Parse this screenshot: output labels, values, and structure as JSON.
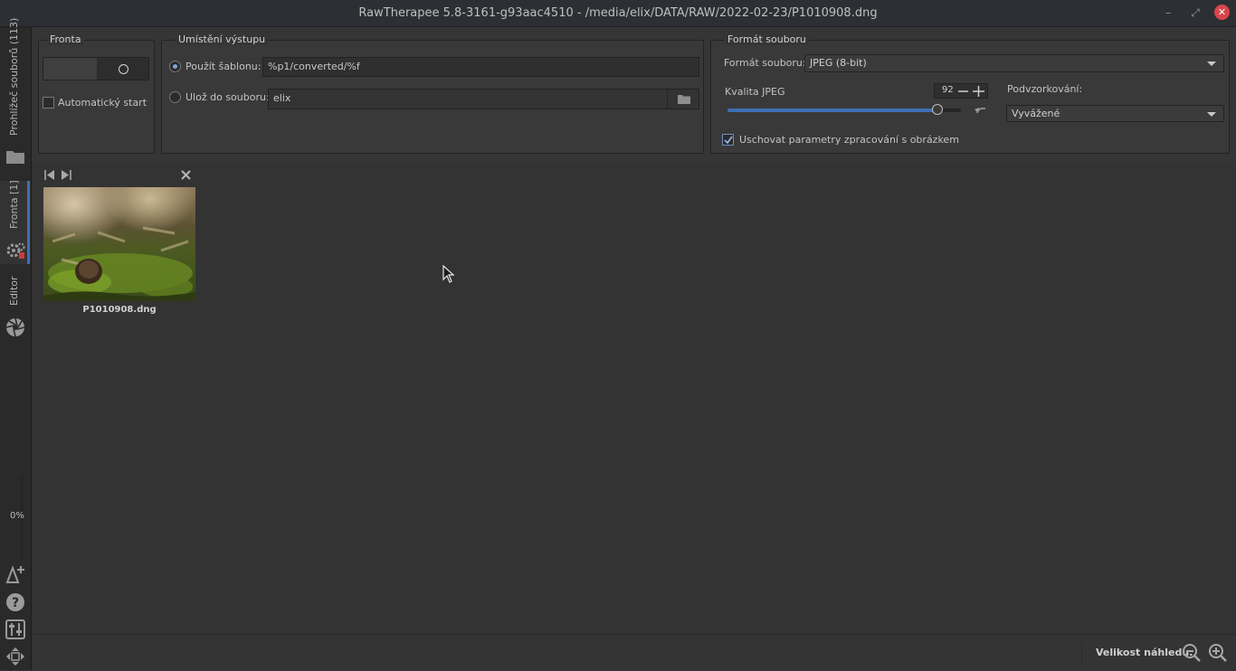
{
  "window": {
    "title": "RawTherapee 5.8-3161-g93aac4510 - /media/elix/DATA/RAW/2022-02-23/P1010908.dng",
    "minimize_glyph": "–",
    "maximize_glyph": "⤢",
    "close_glyph": "✕"
  },
  "sidebar": {
    "tabs": [
      {
        "label": "Prohlížeč souborů (113)",
        "icon": "folder-icon"
      },
      {
        "label": "Fronta [1]",
        "icon": "gears-icon",
        "active": true
      },
      {
        "label": "Editor",
        "icon": "aperture-icon"
      }
    ],
    "progress_label": "0%",
    "progress": 0,
    "bottom_icons": [
      "new-editor-icon",
      "help-icon",
      "preferences-icon",
      "fullscreen-icon"
    ]
  },
  "queue": {
    "title": "Fronta",
    "autostart_label": "Automatický start",
    "autostart_checked": false
  },
  "output": {
    "title": "Umístění výstupu",
    "template_label": "Použít šablonu:",
    "template_value": "%p1/converted/%f",
    "template_selected": true,
    "save_to_label": "Ulož do souboru:",
    "save_to_value": "elix"
  },
  "format": {
    "title": "Formát souboru",
    "format_label": "Formát souboru:",
    "format_value": "JPEG (8-bit)",
    "quality_label": "Kvalita JPEG",
    "quality_value": "92",
    "subsampling_label": "Podvzorkování:",
    "subsampling_value": "Vyvážené",
    "save_params_label": "Uschovat parametry zpracování s obrázkem",
    "save_params_checked": true
  },
  "queue_list": {
    "items": [
      {
        "filename": "P1010908.dng"
      }
    ]
  },
  "statusbar": {
    "thumb_size_label": "Velikost náhledu:"
  },
  "colors": {
    "accent": "#3d6fb5",
    "close_red": "#d8454c",
    "background": "#353535"
  }
}
